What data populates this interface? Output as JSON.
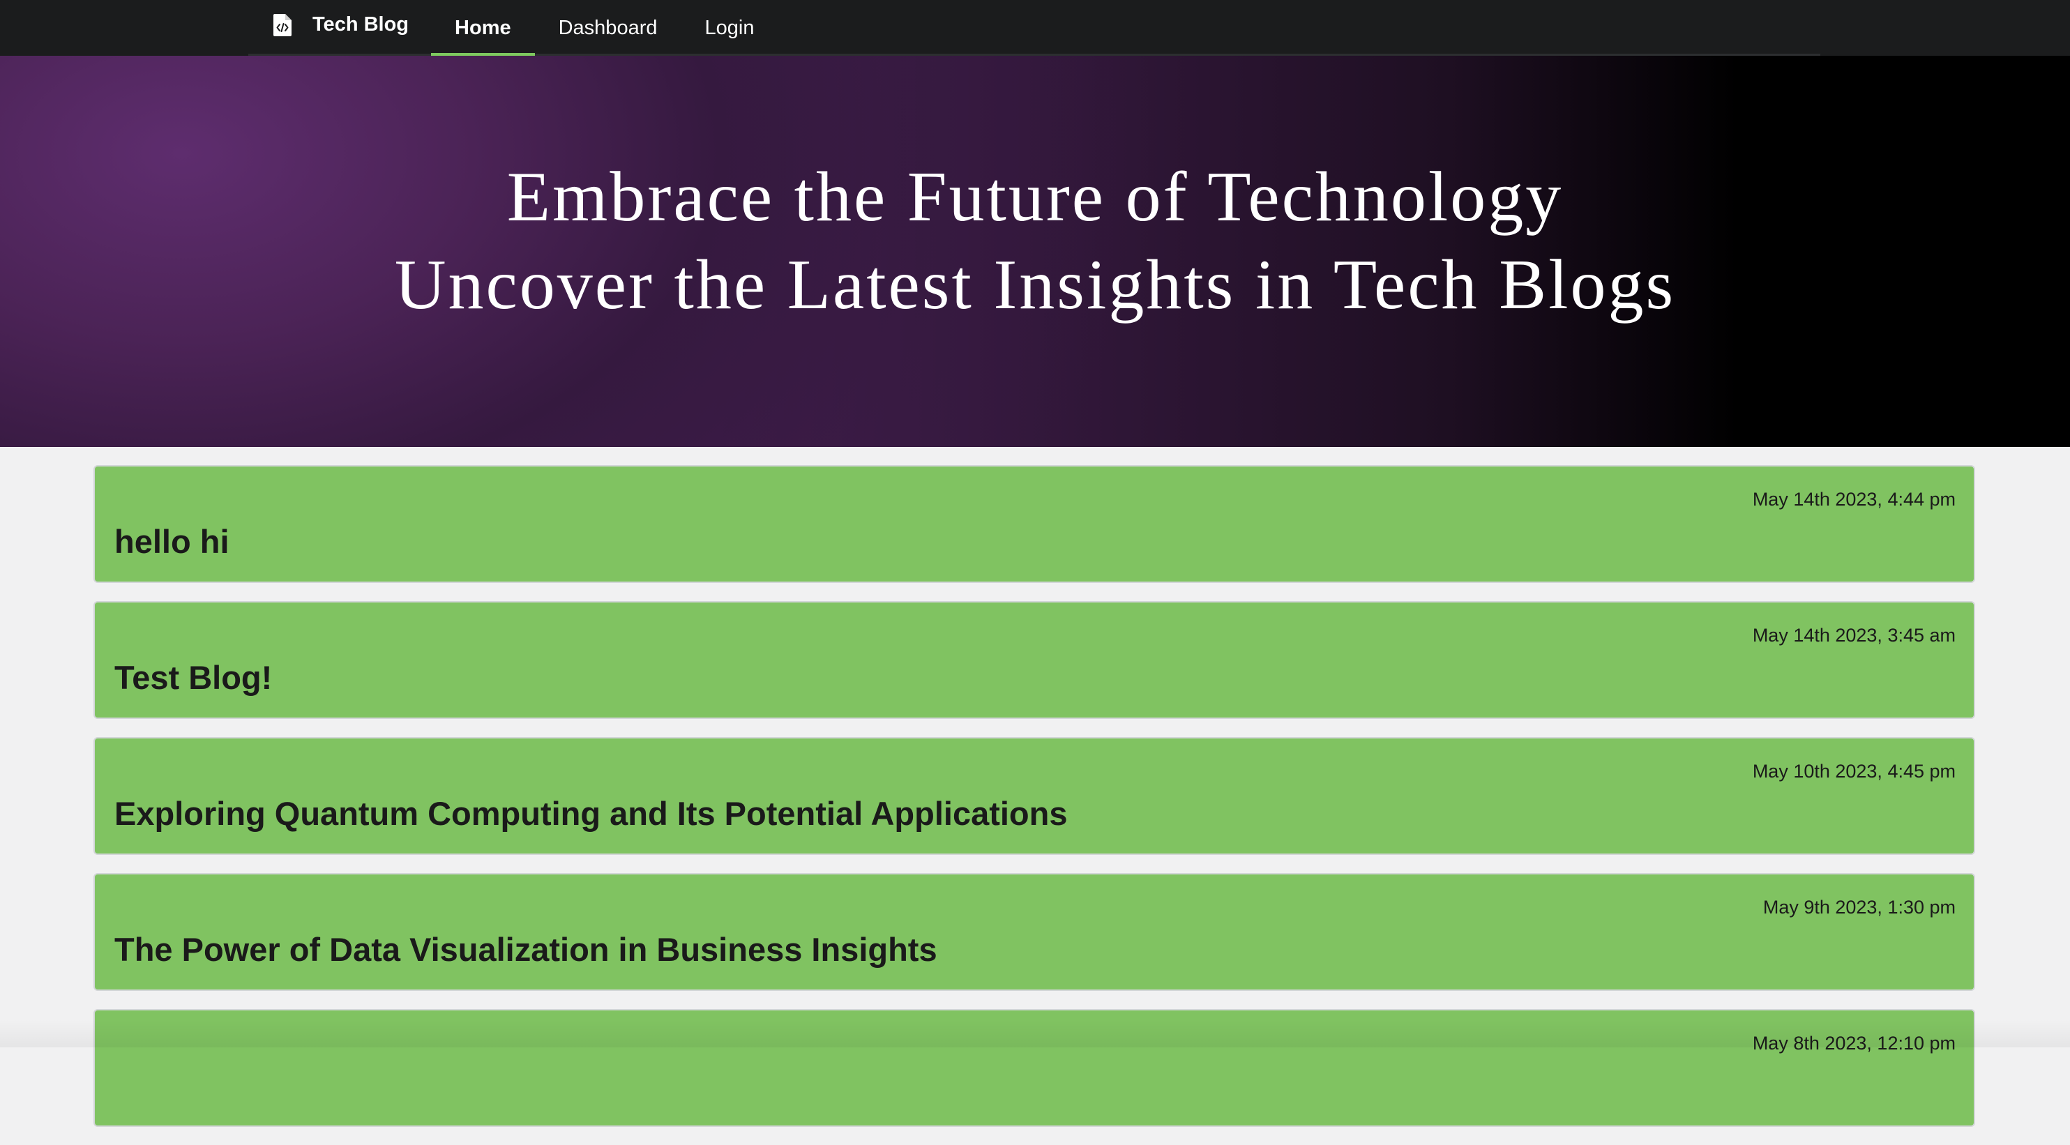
{
  "navbar": {
    "brand_label": "Tech Blog",
    "items": [
      {
        "label": "Home",
        "active": true
      },
      {
        "label": "Dashboard",
        "active": false
      },
      {
        "label": "Login",
        "active": false
      }
    ],
    "accent_color": "#7ec95f"
  },
  "hero": {
    "line1": "Embrace the Future of Technology",
    "line2": "Uncover the Latest Insights in Tech Blogs"
  },
  "posts": [
    {
      "date": "May 14th 2023, 4:44 pm",
      "title": "hello hi"
    },
    {
      "date": "May 14th 2023, 3:45 am",
      "title": "Test Blog!"
    },
    {
      "date": "May 10th 2023, 4:45 pm",
      "title": "Exploring Quantum Computing and Its Potential Applications"
    },
    {
      "date": "May 9th 2023, 1:30 pm",
      "title": "The Power of Data Visualization in Business Insights"
    },
    {
      "date": "May 8th 2023, 12:10 pm",
      "title": ""
    }
  ],
  "colors": {
    "card_green": "#80c361",
    "navbar_bg": "#1b1c1d",
    "page_bg": "#f1f1f2"
  }
}
